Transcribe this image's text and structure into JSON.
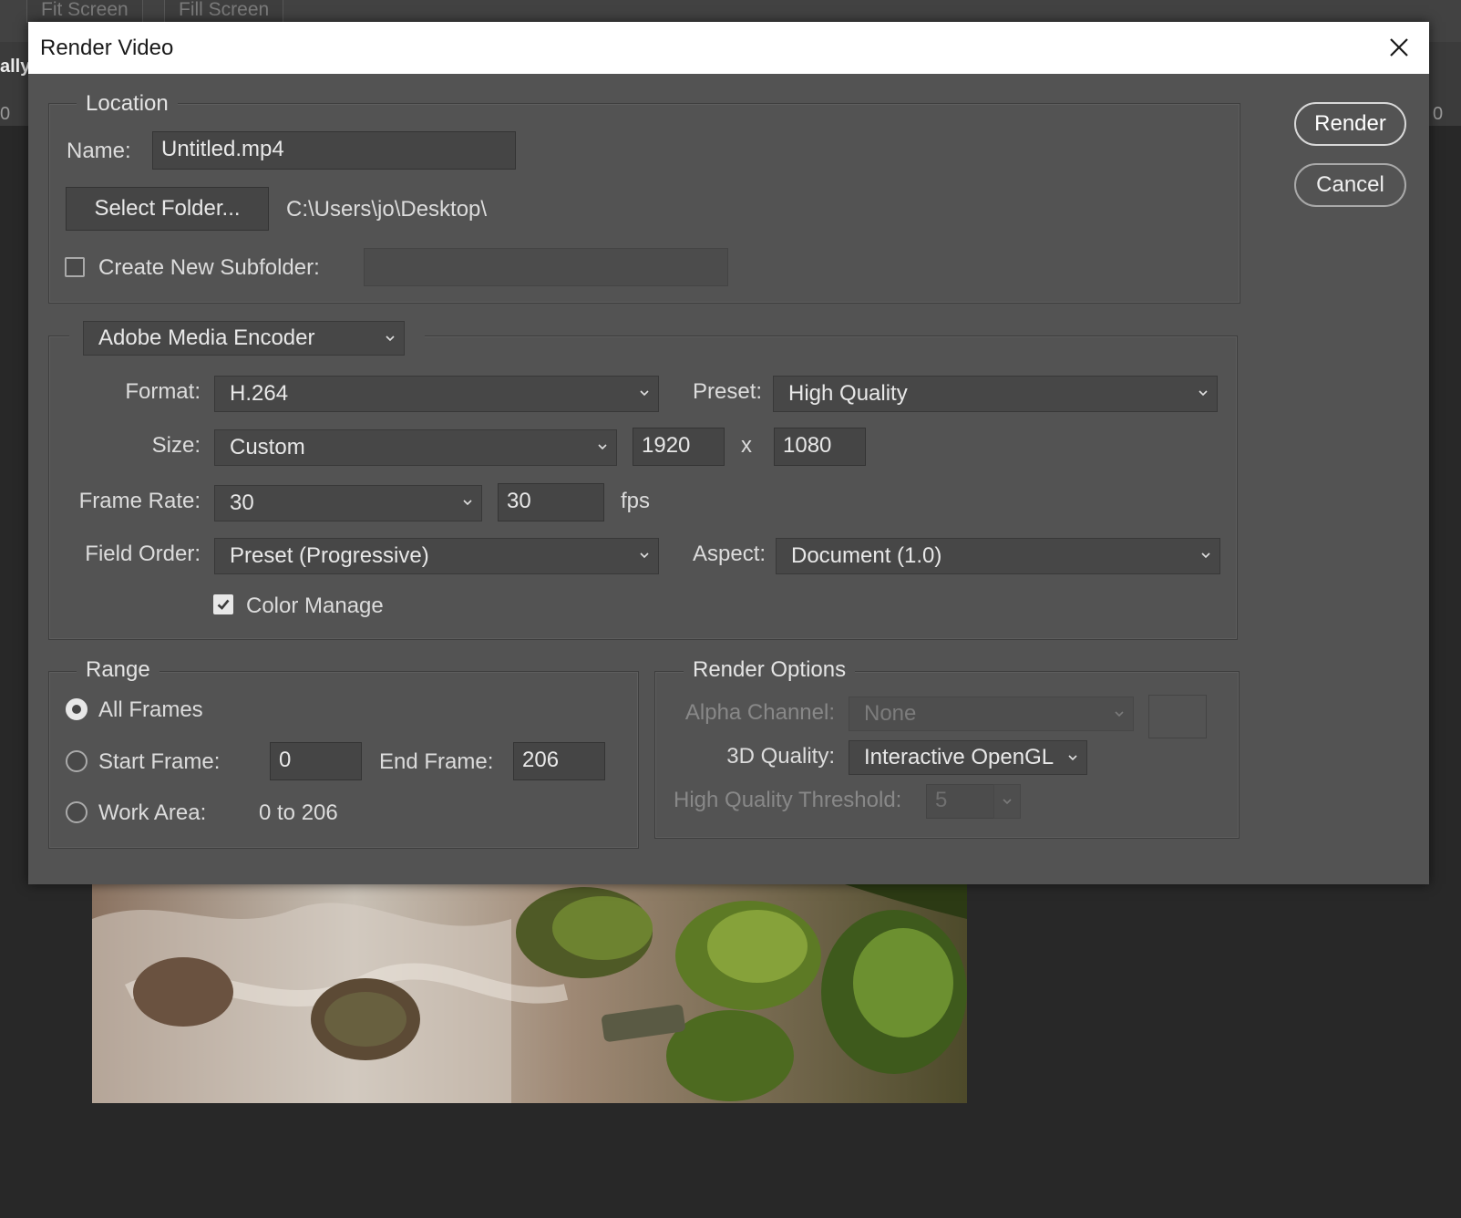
{
  "workspace": {
    "tabs": [
      "Fit Screen",
      "Fill Screen"
    ],
    "sidebar_fragment": "ally",
    "ruler_left": "0",
    "ruler_right": "0"
  },
  "dialog": {
    "title": "Render Video",
    "buttons": {
      "render": "Render",
      "cancel": "Cancel"
    },
    "location": {
      "legend": "Location",
      "name_label": "Name:",
      "name_value": "Untitled.mp4",
      "select_folder": "Select Folder...",
      "folder_path": "C:\\Users\\jo\\Desktop\\",
      "subfolder_label": "Create New Subfolder:",
      "subfolder_checked": false,
      "subfolder_value": ""
    },
    "encoder": {
      "selected": "Adobe Media Encoder",
      "format_label": "Format:",
      "format_value": "H.264",
      "preset_label": "Preset:",
      "preset_value": "High Quality",
      "size_label": "Size:",
      "size_value": "Custom",
      "width": "1920",
      "size_x": "x",
      "height": "1080",
      "frame_rate_label": "Frame Rate:",
      "frame_rate_select": "30",
      "frame_rate_value": "30",
      "fps": "fps",
      "field_order_label": "Field Order:",
      "field_order_value": "Preset (Progressive)",
      "aspect_label": "Aspect:",
      "aspect_value": "Document (1.0)",
      "color_manage_label": "Color Manage",
      "color_manage_checked": true
    },
    "range": {
      "legend": "Range",
      "all_frames": "All Frames",
      "start_frame_label": "Start Frame:",
      "start_frame_value": "0",
      "end_frame_label": "End Frame:",
      "end_frame_value": "206",
      "work_area_label": "Work Area:",
      "work_area_value": "0 to 206",
      "selected": "All Frames"
    },
    "render_options": {
      "legend": "Render Options",
      "alpha_label": "Alpha Channel:",
      "alpha_value": "None",
      "quality_label": "3D Quality:",
      "quality_value": "Interactive OpenGL",
      "threshold_label": "High Quality Threshold:",
      "threshold_value": "5"
    }
  },
  "colors": {
    "dialog_bg": "#535353",
    "field_bg": "#454545",
    "titlebar_bg": "#ffffff"
  }
}
